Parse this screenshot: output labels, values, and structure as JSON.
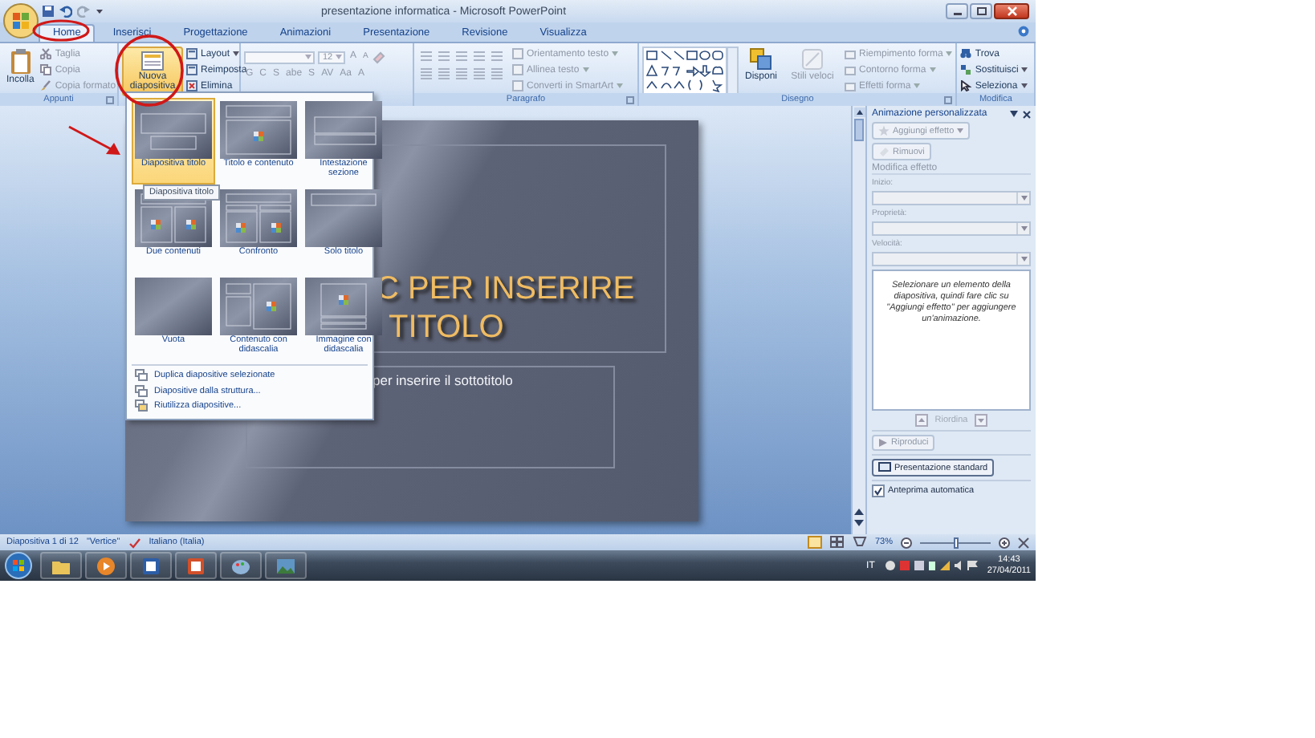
{
  "window": {
    "title": "presentazione informatica - Microsoft PowerPoint"
  },
  "tabs": [
    {
      "label": "Home",
      "selected": true
    },
    {
      "label": "Inserisci",
      "selected": false
    },
    {
      "label": "Progettazione",
      "selected": false
    },
    {
      "label": "Animazioni",
      "selected": false
    },
    {
      "label": "Presentazione",
      "selected": false
    },
    {
      "label": "Revisione",
      "selected": false
    },
    {
      "label": "Visualizza",
      "selected": false
    }
  ],
  "clipboard": {
    "label": "Appunti",
    "paste": {
      "label": "Incolla"
    },
    "items": [
      {
        "label": "Taglia",
        "disabled": true
      },
      {
        "label": "Copia",
        "disabled": true
      },
      {
        "label": "Copia formato",
        "disabled": true
      }
    ]
  },
  "slides_group": {
    "new_slide": {
      "label": "Nuova diapositiva",
      "expanded": true
    },
    "items": [
      {
        "label": "Layout",
        "disabled": false,
        "dropdown": true
      },
      {
        "label": "Reimposta",
        "disabled": false,
        "dropdown": false
      },
      {
        "label": "Elimina",
        "disabled": false,
        "dropdown": false
      }
    ]
  },
  "font": {
    "size": {
      "value": "12",
      "disabled": true
    },
    "size_buttons": [
      "A",
      "A"
    ],
    "format_buttons": [
      "G",
      "C",
      "S",
      "abe",
      "S",
      "AV",
      "Aa",
      "A"
    ]
  },
  "paragraph": {
    "label": "Paragrafo",
    "items": [
      {
        "label": "Orientamento testo",
        "disabled": true,
        "dropdown": true
      },
      {
        "label": "Allinea testo",
        "disabled": true,
        "dropdown": true
      },
      {
        "label": "Converti in SmartArt",
        "disabled": true,
        "dropdown": true
      }
    ]
  },
  "drawing": {
    "label": "Disegno",
    "arrange": {
      "label": "Disponi",
      "disabled": false
    },
    "quick_styles": {
      "label": "Stili veloci",
      "disabled": true
    },
    "items": [
      {
        "label": "Riempimento forma",
        "disabled": true,
        "dropdown": true
      },
      {
        "label": "Contorno forma",
        "disabled": true,
        "dropdown": true
      },
      {
        "label": "Effetti forma",
        "disabled": true,
        "dropdown": true
      }
    ]
  },
  "editing": {
    "label": "Modifica",
    "items": [
      {
        "label": "Trova",
        "disabled": false,
        "dropdown": false
      },
      {
        "label": "Sostituisci",
        "disabled": false,
        "dropdown": true
      },
      {
        "label": "Seleziona",
        "disabled": false,
        "dropdown": true
      }
    ]
  },
  "slide": {
    "title_lines": [
      "C PER INSERIRE",
      "TITOLO"
    ],
    "subtitle": "per inserire il sottotitolo"
  },
  "new_slide_menu": {
    "layouts": [
      {
        "label": "Diapositiva titolo",
        "kind": "title",
        "selected": true
      },
      {
        "label": "Titolo e contenuto",
        "kind": "title-content",
        "selected": false
      },
      {
        "label": "Intestazione sezione",
        "kind": "section",
        "selected": false
      },
      {
        "label": "Due contenuti",
        "kind": "two-content",
        "selected": false
      },
      {
        "label": "Confronto",
        "kind": "comparison",
        "selected": false
      },
      {
        "label": "Solo titolo",
        "kind": "title-only",
        "selected": false
      },
      {
        "label": "Vuota",
        "kind": "blank",
        "selected": false
      },
      {
        "label": "Contenuto con didascalia",
        "kind": "content-caption",
        "selected": false
      },
      {
        "label": "Immagine con didascalia",
        "kind": "picture-caption",
        "selected": false
      }
    ],
    "tooltip": "Diapositiva titolo",
    "commands": [
      "Duplica diapositive selezionate",
      "Diapositive dalla struttura...",
      "Riutilizza diapositive..."
    ]
  },
  "task_pane": {
    "title": "Animazione personalizzata",
    "add_effect": {
      "label": "Aggiungi effetto",
      "disabled": true
    },
    "remove": {
      "label": "Rimuovi",
      "disabled": true
    },
    "section": "Modifica effetto",
    "fields": [
      {
        "label": "Inizio:",
        "disabled": true
      },
      {
        "label": "Proprietà:",
        "disabled": true
      },
      {
        "label": "Velocità:",
        "disabled": true
      }
    ],
    "hint": "Selezionare un elemento della diapositiva, quindi fare clic su \"Aggiungi effetto\" per aggiungere un'animazione.",
    "reorder": "Riordina",
    "play": {
      "label": "Riproduci",
      "disabled": true
    },
    "slideshow": "Presentazione standard",
    "autopreview": {
      "label": "Anteprima automatica",
      "checked": true
    }
  },
  "status_bar": {
    "slide": "Diapositiva 1 di 12",
    "theme": "\"Vertice\"",
    "language": "Italiano (Italia)",
    "zoom": "73%",
    "zoom_slider": {
      "level": 0.5
    }
  },
  "taskbar": {
    "apps": [
      {
        "kind": "folder"
      },
      {
        "kind": "media"
      },
      {
        "kind": "word"
      },
      {
        "kind": "powerpoint"
      },
      {
        "kind": "paint"
      },
      {
        "kind": "photos"
      }
    ],
    "language": "IT",
    "time": "14:43",
    "date": "27/04/2011"
  }
}
